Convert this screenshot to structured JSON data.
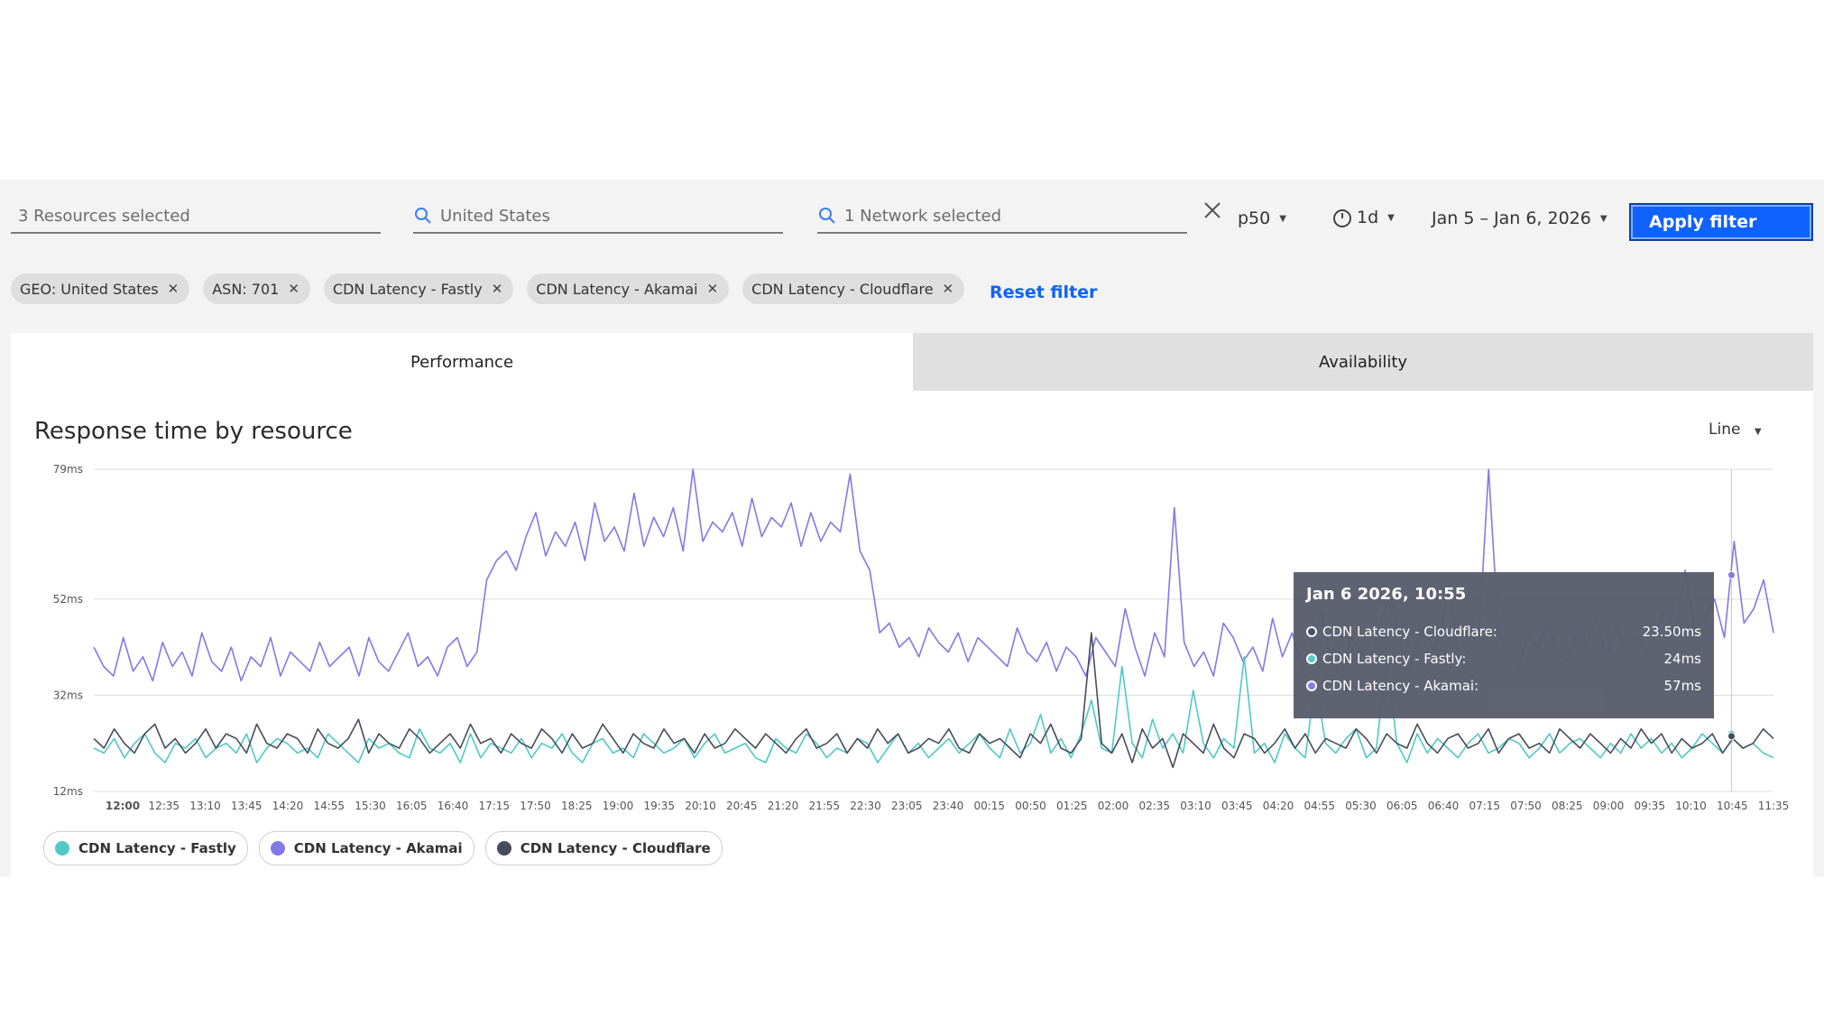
{
  "filters": {
    "resources": "3 Resources selected",
    "geo": "United States",
    "network": "1 Network selected",
    "percentile": "p50",
    "interval": "1d",
    "date_range": "Jan 5 – Jan 6, 2026",
    "apply_label": "Apply filter",
    "reset_label": "Reset filter"
  },
  "chips": [
    {
      "label": "GEO: United States"
    },
    {
      "label": "ASN: 701"
    },
    {
      "label": "CDN Latency - Fastly"
    },
    {
      "label": "CDN Latency - Akamai"
    },
    {
      "label": "CDN Latency - Cloudflare"
    }
  ],
  "tabs": [
    {
      "label": "Performance",
      "active": true
    },
    {
      "label": "Availability",
      "active": false
    }
  ],
  "colors": {
    "accent": "#0f62fe",
    "fastly": "#4ec9c6",
    "akamai": "#8378e8",
    "cloudflare": "#474c5b"
  },
  "chart": {
    "title": "Response time by resource",
    "type_selector": "Line"
  },
  "chart_data": {
    "type": "line",
    "title": "Response time by resource",
    "y_ticks": [
      "79ms",
      "52ms",
      "32ms",
      "12ms"
    ],
    "y_tick_values": [
      79,
      52,
      32,
      12
    ],
    "ylim": [
      12,
      79
    ],
    "x_ticks": [
      "12:00",
      "12:35",
      "13:10",
      "13:45",
      "14:20",
      "14:55",
      "15:30",
      "16:05",
      "16:40",
      "17:15",
      "17:50",
      "18:25",
      "19:00",
      "19:35",
      "20:10",
      "20:45",
      "21:20",
      "21:55",
      "22:30",
      "23:05",
      "23:40",
      "00:15",
      "00:50",
      "01:25",
      "02:00",
      "02:35",
      "03:10",
      "03:45",
      "04:20",
      "04:55",
      "05:30",
      "06:05",
      "06:40",
      "07:15",
      "07:50",
      "08:25",
      "09:00",
      "09:35",
      "10:10",
      "10:45",
      "11:35"
    ],
    "grid": true,
    "legend": "bottom-left",
    "series": [
      {
        "name": "CDN Latency - Fastly",
        "color": "#4ec9c6",
        "shape": "noisy ~21ms, spikes to ~40ms around 02:00 and 04:20",
        "values": [
          21,
          20,
          23,
          19,
          22,
          24,
          20,
          18,
          22,
          21,
          23,
          19,
          21,
          22,
          20,
          24,
          18,
          21,
          23,
          22,
          20,
          21,
          19,
          24,
          22,
          20,
          18,
          23,
          21,
          22,
          20,
          19,
          25,
          21,
          20,
          22,
          18,
          24,
          19,
          22,
          21,
          20,
          23,
          19,
          22,
          21,
          24,
          20,
          18,
          22,
          23,
          20,
          21,
          19,
          24,
          22,
          20,
          21,
          23,
          19,
          22,
          24,
          20,
          21,
          22,
          19,
          18,
          23,
          21,
          20,
          24,
          22,
          19,
          21,
          20,
          23,
          22,
          18,
          21,
          24,
          20,
          22,
          19,
          21,
          23,
          20,
          22,
          24,
          21,
          19,
          25,
          20,
          22,
          28,
          20,
          23,
          19,
          24,
          31,
          21,
          20,
          38,
          22,
          19,
          27,
          21,
          24,
          20,
          33,
          22,
          19,
          23,
          21,
          40,
          20,
          22,
          18,
          24,
          21,
          19,
          35,
          22,
          20,
          23,
          25,
          19,
          21,
          40,
          22,
          18,
          24,
          20,
          23,
          21,
          19,
          22,
          24,
          20,
          21,
          23,
          22,
          19,
          21,
          24,
          20,
          22,
          23,
          21,
          19,
          22,
          20,
          24,
          21,
          23,
          20,
          22,
          19,
          21,
          24,
          22,
          20,
          23,
          21,
          22,
          20,
          19
        ]
      },
      {
        "name": "CDN Latency - Akamai",
        "color": "#8378e8",
        "shape": "~38-45ms, rises to ~60-79ms 17:15–21:55, then ~35-45ms with spikes",
        "values": [
          42,
          38,
          36,
          44,
          37,
          40,
          35,
          43,
          38,
          41,
          36,
          45,
          39,
          37,
          42,
          35,
          40,
          38,
          44,
          36,
          41,
          39,
          37,
          43,
          38,
          40,
          42,
          36,
          44,
          39,
          37,
          41,
          45,
          38,
          40,
          36,
          42,
          44,
          38,
          41,
          56,
          60,
          62,
          58,
          65,
          70,
          61,
          66,
          63,
          68,
          60,
          72,
          64,
          67,
          62,
          74,
          63,
          69,
          65,
          71,
          62,
          79,
          64,
          68,
          66,
          70,
          63,
          73,
          65,
          69,
          67,
          72,
          63,
          70,
          64,
          68,
          66,
          78,
          62,
          58,
          45,
          47,
          42,
          44,
          40,
          46,
          43,
          41,
          45,
          39,
          44,
          42,
          40,
          38,
          46,
          41,
          39,
          43,
          37,
          42,
          40,
          36,
          44,
          41,
          38,
          50,
          42,
          36,
          45,
          40,
          71,
          43,
          38,
          41,
          36,
          47,
          44,
          39,
          42,
          37,
          48,
          40,
          45,
          38,
          43,
          49,
          39,
          36,
          44,
          41,
          40,
          47,
          53,
          42,
          38,
          46,
          40,
          44,
          55,
          39,
          41,
          43,
          79,
          45,
          40,
          38,
          44,
          42,
          47,
          41,
          39,
          45,
          43,
          48,
          40,
          46,
          42,
          44,
          41,
          45,
          50,
          44,
          58,
          46,
          48,
          52,
          44,
          64,
          47,
          50,
          56,
          45
        ]
      },
      {
        "name": "CDN Latency - Cloudflare",
        "color": "#474c5b",
        "shape": "noisy ~22ms with occasional spikes, stays near 20-28ms",
        "values": [
          23,
          21,
          25,
          22,
          20,
          24,
          26,
          21,
          23,
          20,
          22,
          25,
          21,
          24,
          23,
          20,
          26,
          22,
          21,
          24,
          23,
          20,
          25,
          22,
          21,
          23,
          27,
          20,
          24,
          22,
          21,
          25,
          23,
          20,
          22,
          24,
          21,
          26,
          22,
          23,
          20,
          24,
          22,
          21,
          25,
          23,
          20,
          24,
          21,
          22,
          26,
          23,
          20,
          24,
          22,
          21,
          25,
          22,
          23,
          20,
          24,
          21,
          22,
          25,
          23,
          21,
          24,
          22,
          20,
          23,
          25,
          21,
          22,
          24,
          20,
          23,
          21,
          25,
          22,
          24,
          20,
          21,
          23,
          22,
          25,
          21,
          20,
          24,
          22,
          23,
          21,
          19,
          24,
          22,
          26,
          21,
          20,
          23,
          45,
          22,
          20,
          24,
          18,
          25,
          21,
          23,
          17,
          24,
          22,
          20,
          26,
          21,
          19,
          24,
          23,
          20,
          22,
          25,
          21,
          24,
          20,
          23,
          22,
          21,
          25,
          23,
          20,
          24,
          22,
          21,
          26,
          22,
          20,
          23,
          24,
          21,
          22,
          25,
          20,
          23,
          24,
          21,
          22,
          20,
          25,
          23,
          21,
          24,
          22,
          20,
          23,
          21,
          25,
          22,
          24,
          20,
          23,
          21,
          22,
          24,
          20,
          23,
          21,
          22,
          25,
          23
        ]
      }
    ]
  },
  "tooltip": {
    "title": "Jan 6 2026, 10:55",
    "rows": [
      {
        "label": "CDN Latency - Cloudflare:",
        "value": "23.50ms",
        "color": "#474c5b"
      },
      {
        "label": "CDN Latency - Fastly:",
        "value": "24ms",
        "color": "#4ec9c6"
      },
      {
        "label": "CDN Latency - Akamai:",
        "value": "57ms",
        "color": "#8378e8"
      }
    ]
  },
  "legend": [
    {
      "label": "CDN Latency - Fastly",
      "color": "#4ec9c6"
    },
    {
      "label": "CDN Latency - Akamai",
      "color": "#8378e8"
    },
    {
      "label": "CDN Latency - Cloudflare",
      "color": "#474c5b"
    }
  ]
}
